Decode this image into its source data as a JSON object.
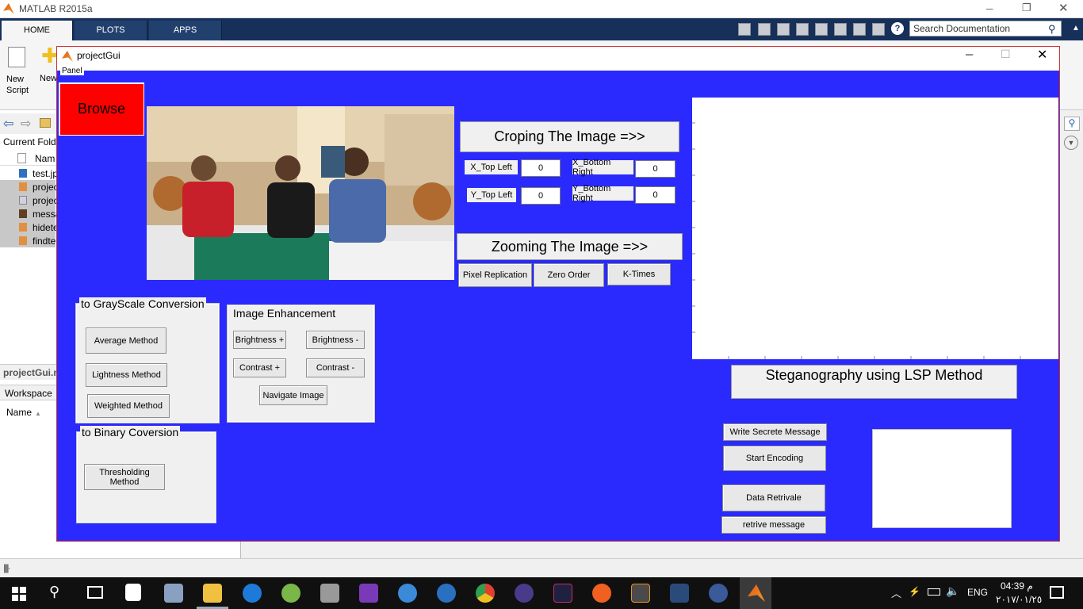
{
  "matlab": {
    "title": "MATLAB R2015a",
    "tabs": [
      "HOME",
      "PLOTS",
      "APPS"
    ],
    "search_placeholder": "Search Documentation",
    "ribbon": {
      "new_script": "New\nScript",
      "new": "New"
    },
    "current_folder": "Current Folde",
    "name_col": "Nam",
    "files": [
      "test.jp",
      "projec",
      "projec",
      "messa",
      "hidete",
      "findte"
    ],
    "details_label": "projectGui.m",
    "workspace_label": "Workspace",
    "workspace_name_col": "Name"
  },
  "gui": {
    "title": "projectGui",
    "panel_label": "Panel",
    "browse": "Browse",
    "crop_title": "Croping The Image =>>",
    "crop": {
      "x_top_left": "X_Top Left",
      "x_top_left_value": "0",
      "y_top_left": "Y_Top Left",
      "y_top_left_value": "0",
      "x_bottom_right": "X_Bottom Right",
      "x_bottom_right_value": "0",
      "y_bottom_right": "Y_Bottom Right",
      "y_bottom_right_value": "0"
    },
    "zoom_title": "Zooming The Image =>>",
    "zoom_buttons": [
      "Pixel Replication",
      "Zero Order",
      "K-Times"
    ],
    "grayscale": {
      "title": "to GrayScale Conversion",
      "buttons": [
        "Average Method",
        "Lightness Method",
        "Weighted Method"
      ]
    },
    "enhance": {
      "title": "Image Enhancement",
      "brightness_plus": "Brightness +",
      "brightness_minus": "Brightness -",
      "contrast_plus": "Contrast +",
      "contrast_minus": "Contrast -",
      "navigate": "Navigate Image"
    },
    "binary": {
      "title": "to Binary Coversion",
      "threshold": "Thresholding Method"
    },
    "stego_title": "Steganography using LSP Method",
    "stego_buttons": {
      "write": "Write Secrete Message",
      "encode": "Start Encoding",
      "retrieve_data": "Data Retrivale",
      "retrieve_msg": "retrive message"
    }
  },
  "taskbar": {
    "lang": "ENG",
    "time": "04:39 م",
    "date": "٢٠١٧/٠١/٢٥"
  },
  "colors": {
    "panel_blue": "#2a2aff",
    "browse_red": "#ff0000",
    "matlab_tabbar": "#16305a"
  }
}
